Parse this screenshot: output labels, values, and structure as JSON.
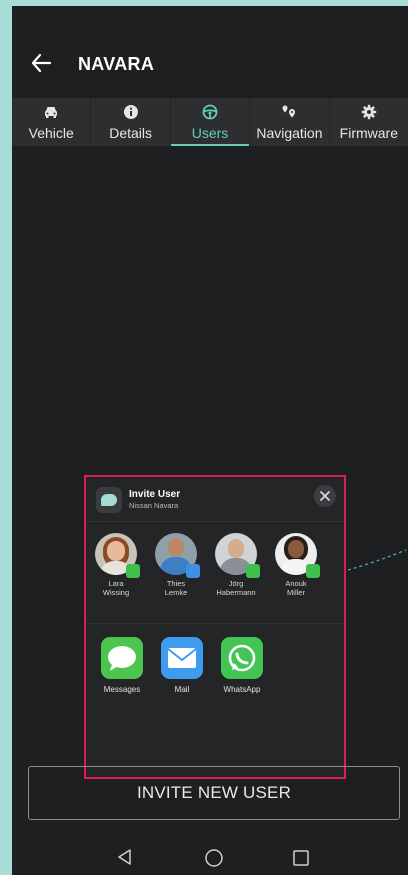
{
  "header": {
    "title": "NAVARA",
    "back_icon": "arrow-left-icon"
  },
  "tabs": [
    {
      "label": "Vehicle",
      "icon": "car-icon",
      "active": false
    },
    {
      "label": "Details",
      "icon": "info-icon",
      "active": false
    },
    {
      "label": "Users",
      "icon": "steering-wheel-icon",
      "active": true
    },
    {
      "label": "Navigation",
      "icon": "map-pins-icon",
      "active": false
    },
    {
      "label": "Firmware",
      "icon": "gear-icon",
      "active": false
    }
  ],
  "share_sheet": {
    "title": "Invite User",
    "subtitle": "Nissan Navara",
    "contacts": [
      {
        "name_line1": "Lara",
        "name_line2": "Wissing",
        "badge": "whatsapp-icon"
      },
      {
        "name_line1": "Thies",
        "name_line2": "Lemke",
        "badge": "mail-icon"
      },
      {
        "name_line1": "Jörg",
        "name_line2": "Habermann",
        "badge": "whatsapp-icon"
      },
      {
        "name_line1": "Anouk",
        "name_line2": "Miller",
        "badge": "whatsapp-icon"
      }
    ],
    "apps": [
      {
        "label": "Messages",
        "icon": "messages-icon"
      },
      {
        "label": "Mail",
        "icon": "mail-icon"
      },
      {
        "label": "WhatsApp",
        "icon": "whatsapp-icon"
      }
    ]
  },
  "invite_button": {
    "label": "INVITE NEW USER"
  },
  "colors": {
    "accent": "#62cdb8",
    "highlight_border": "#e01a59",
    "background": "#1e1f20"
  }
}
